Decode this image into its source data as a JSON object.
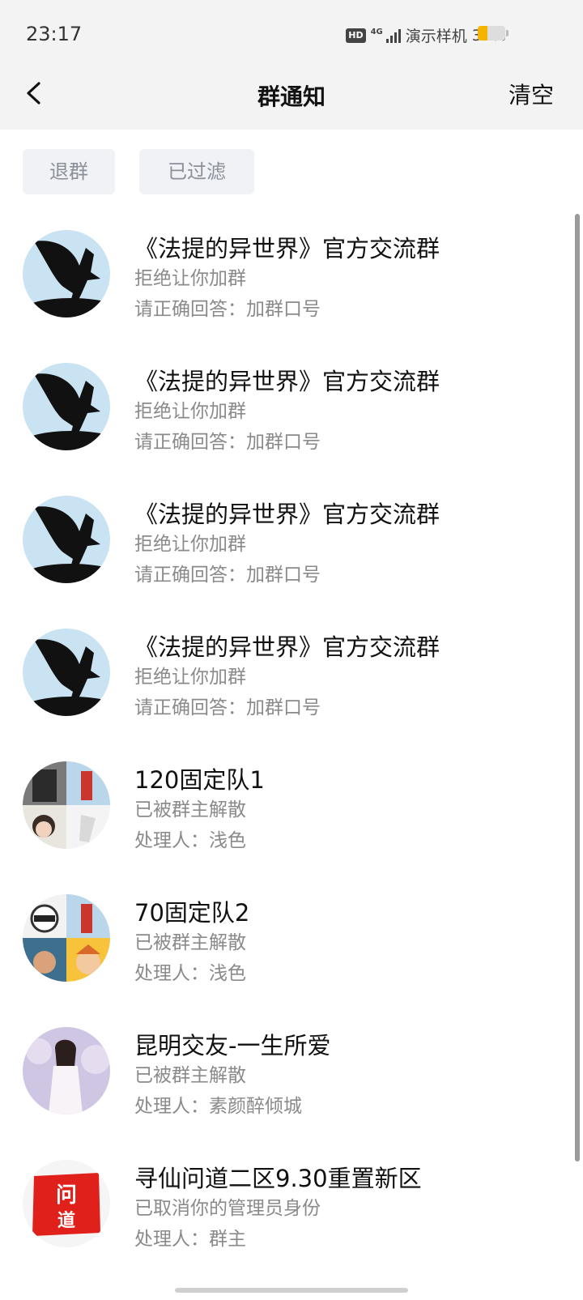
{
  "status_bar": {
    "time": "23:17",
    "hd": "HD",
    "network": "4G",
    "carrier": "演示样机",
    "battery_text": "34%",
    "battery_level": 0.34
  },
  "nav": {
    "title": "群通知",
    "clear_label": "清空",
    "back_icon": "chevron-left-icon"
  },
  "filters": [
    {
      "label": "退群"
    },
    {
      "label": "已过滤"
    }
  ],
  "notifications": [
    {
      "title": "《法提的异世界》官方交流群",
      "status": "拒绝让你加群",
      "detail": "请正确回答：加群口号",
      "avatar": "eagle"
    },
    {
      "title": "《法提的异世界》官方交流群",
      "status": "拒绝让你加群",
      "detail": "请正确回答：加群口号",
      "avatar": "eagle"
    },
    {
      "title": "《法提的异世界》官方交流群",
      "status": "拒绝让你加群",
      "detail": "请正确回答：加群口号",
      "avatar": "eagle"
    },
    {
      "title": "《法提的异世界》官方交流群",
      "status": "拒绝让你加群",
      "detail": "请正确回答：加群口号",
      "avatar": "eagle"
    },
    {
      "title": "120固定队1",
      "status": "已被群主解散",
      "detail": "处理人：浅色",
      "avatar": "mosaic"
    },
    {
      "title": "70固定队2",
      "status": "已被群主解散",
      "detail": "处理人：浅色",
      "avatar": "mosaic"
    },
    {
      "title": "昆明交友-一生所爱",
      "status": "已被群主解散",
      "detail": "处理人：素颜醉倾城",
      "avatar": "portrait"
    },
    {
      "title": "寻仙问道二区9.30重置新区",
      "status": "已取消你的管理员身份",
      "detail": "处理人：群主",
      "avatar": "seal",
      "avatar_text": "问道"
    }
  ],
  "colors": {
    "accent_battery": "#f4b400",
    "seal_red": "#e0201a",
    "sky_blue": "#c9e3f3"
  }
}
